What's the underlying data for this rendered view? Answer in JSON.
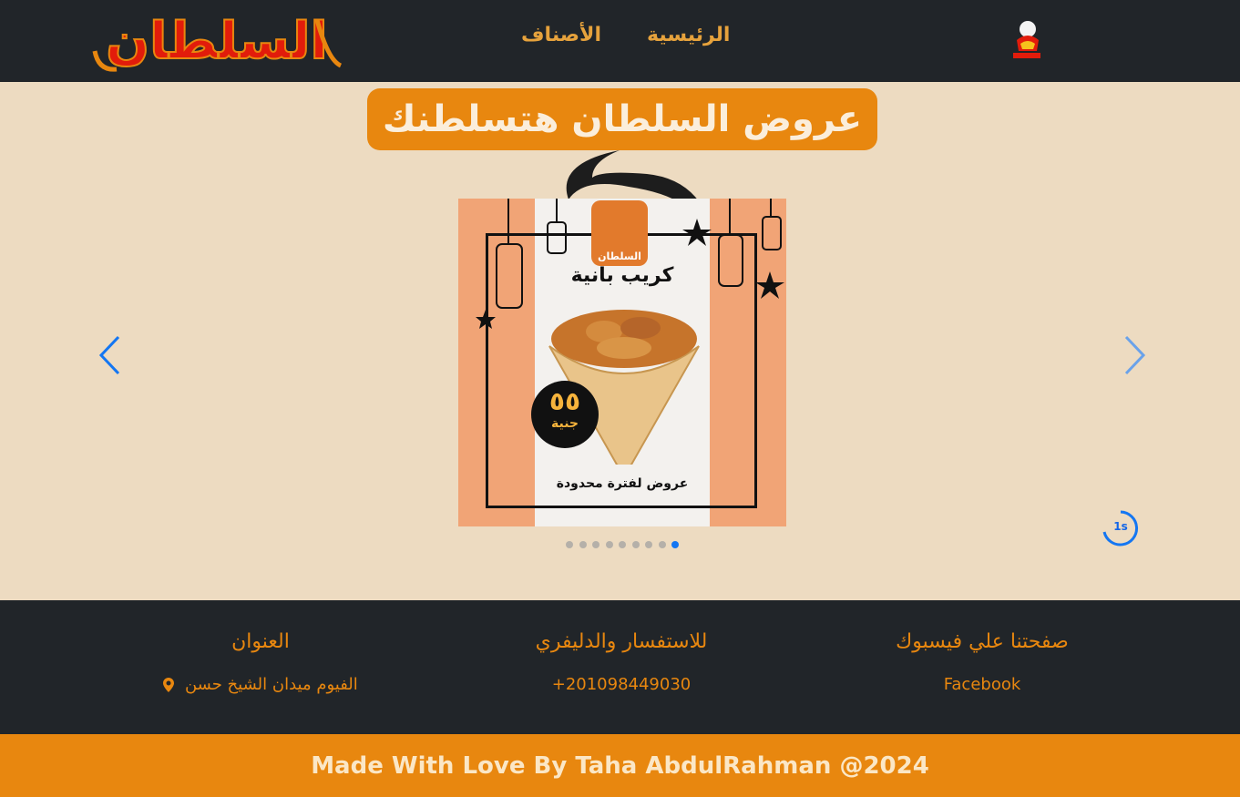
{
  "navbar": {
    "brand_text": "السلطان",
    "links": [
      {
        "label": "الرئيسية"
      },
      {
        "label": "الأصناف"
      }
    ]
  },
  "hero": {
    "title": "عروض السلطان هتسلطنك",
    "slide": {
      "logo_text": "السلطان",
      "product_title": "كريب بانية",
      "price_value": "٥٥",
      "price_unit": "جنية",
      "note": "عروض لفترة محدودة"
    },
    "autoplay_label": "1s",
    "slide_count": 9,
    "active_slide_index": 8
  },
  "footer": {
    "facebook": {
      "title": "صفحتنا علي فيسبوك",
      "link_label": "Facebook"
    },
    "contact": {
      "title": "للاستفسار والدليفري",
      "phone": "+201098449030"
    },
    "address": {
      "title": "العنوان",
      "text": "الفيوم ميدان الشيخ حسن"
    }
  },
  "copyright": {
    "text": "Made With Love By Taha AbdulRahman @2024"
  },
  "colors": {
    "navbar_bg": "#212529",
    "accent": "#e8870f",
    "page_bg": "#eddbc1",
    "carousel_blue": "#1476f2"
  }
}
